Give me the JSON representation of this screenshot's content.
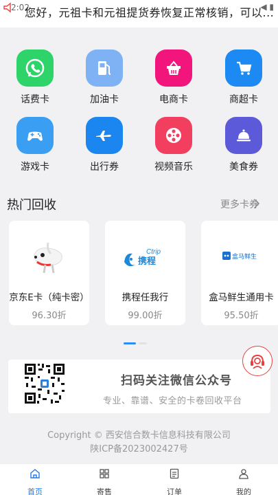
{
  "status_bar": {
    "time": "2:02",
    "icons": "◀ ▮"
  },
  "notice": {
    "text": "您好，元祖卡和元祖提货券恢复正常核销，可以..."
  },
  "grid": [
    {
      "label": "话费卡",
      "icon": "phone-icon",
      "color": "#2ed36a"
    },
    {
      "label": "加油卡",
      "icon": "fuel-icon",
      "color": "#7fb2f5"
    },
    {
      "label": "电商卡",
      "icon": "basket-icon",
      "color": "#f2157c"
    },
    {
      "label": "商超卡",
      "icon": "cart-icon",
      "color": "#1c8af2"
    },
    {
      "label": "游戏卡",
      "icon": "gamepad-icon",
      "color": "#3a9ef2"
    },
    {
      "label": "出行券",
      "icon": "plane-icon",
      "color": "#1b86f0"
    },
    {
      "label": "视频音乐",
      "icon": "film-reel-icon",
      "color": "#f33f5f"
    },
    {
      "label": "美食券",
      "icon": "bell-icon",
      "color": "#5c5ad8"
    }
  ],
  "hot": {
    "title": "热门回收",
    "more": "更多卡券"
  },
  "cards": [
    {
      "name": "京东E卡（纯卡密）",
      "rate": "96.30折",
      "logo": "jd-dog-logo"
    },
    {
      "name": "携程任我行",
      "rate": "99.00折",
      "logo": "ctrip-logo",
      "logo_en": "Ctrip",
      "logo_cn": "携程"
    },
    {
      "name": "盒马鲜生通用卡",
      "rate": "95.50折",
      "logo": "hema-logo",
      "logo_cn": "盒马鲜生"
    }
  ],
  "qr": {
    "title": "扫码关注微信公众号",
    "subtitle": "专业、靠谱、安全的卡卷回收平台"
  },
  "footer": {
    "line1": "Copyright © 西安信合数卡信息科技有限公司",
    "line2": "陕ICP备2023002427号"
  },
  "tabs": [
    {
      "label": "首页",
      "icon": "home-icon",
      "active": true
    },
    {
      "label": "寄售",
      "icon": "grid-icon",
      "active": false
    },
    {
      "label": "订单",
      "icon": "list-icon",
      "active": false
    },
    {
      "label": "我的",
      "icon": "user-icon",
      "active": false
    }
  ],
  "colors": {
    "accent": "#1f7ae8",
    "service": "#e84040"
  }
}
